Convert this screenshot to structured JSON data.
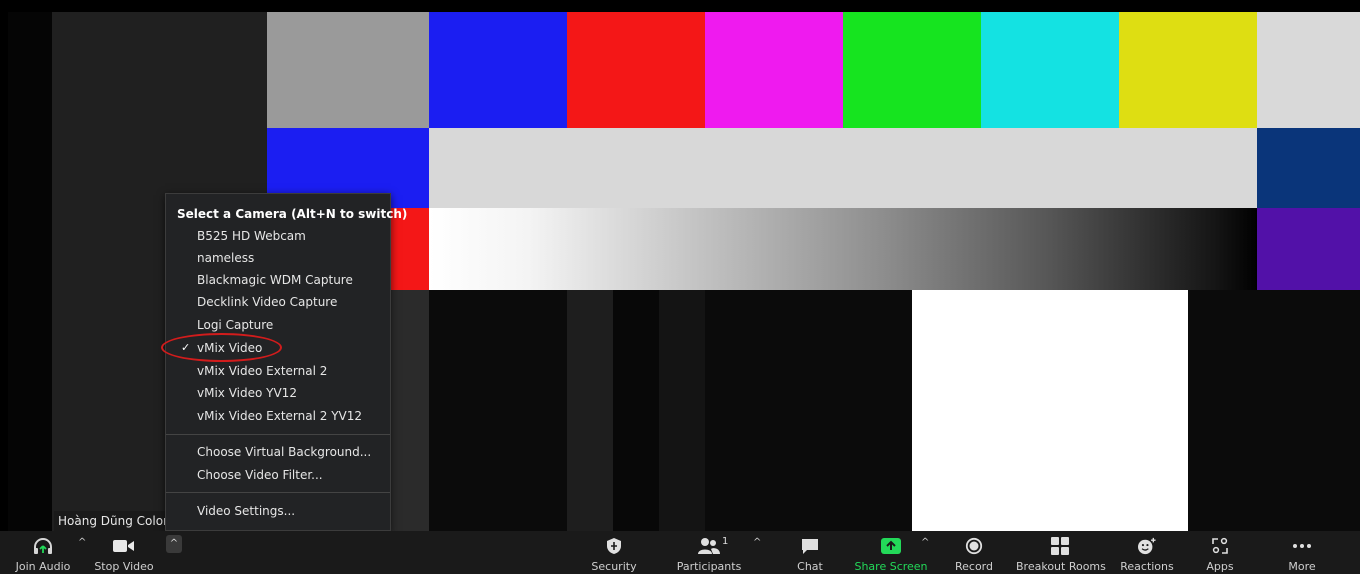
{
  "participant": {
    "name": "Hoàng Dũng ColorM"
  },
  "camera_menu": {
    "header": "Select a Camera (Alt+N to switch)",
    "cameras": [
      "B525 HD Webcam",
      "nameless",
      "Blackmagic WDM Capture",
      "Decklink Video Capture",
      "Logi Capture",
      "vMix Video",
      "vMix Video External 2",
      "vMix Video YV12",
      "vMix Video External 2 YV12"
    ],
    "selected": "vMix Video",
    "check_mark": "✓",
    "options": [
      "Choose Virtual Background...",
      "Choose Video Filter..."
    ],
    "settings": "Video Settings..."
  },
  "toolbar": {
    "join_audio": "Join Audio",
    "stop_video": "Stop Video",
    "security": "Security",
    "participants": "Participants",
    "participants_count": "1",
    "chat": "Chat",
    "share_screen": "Share Screen",
    "record": "Record",
    "breakout_rooms": "Breakout Rooms",
    "reactions": "Reactions",
    "apps": "Apps",
    "more": "More"
  },
  "colors": {
    "share_green": "#23d959",
    "highlight_red": "#d21c1c"
  }
}
